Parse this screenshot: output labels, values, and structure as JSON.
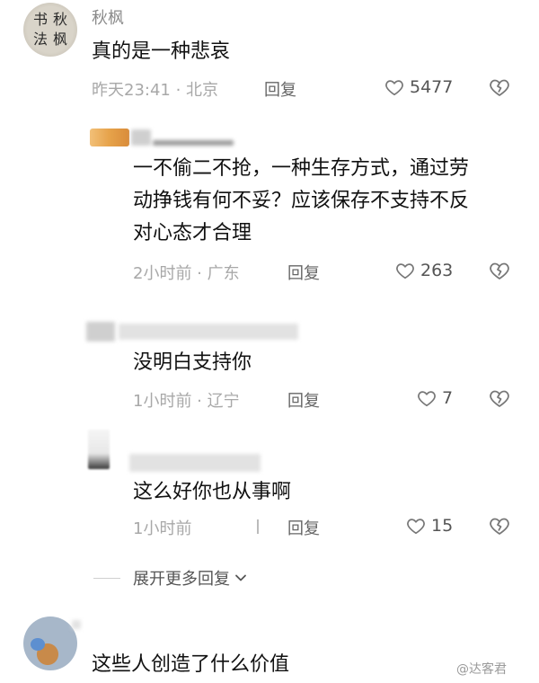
{
  "comments": [
    {
      "username": "秋枫",
      "avatar_text": [
        "书",
        "秋",
        "法",
        "枫"
      ],
      "text": "真的是一种悲哀",
      "meta": "昨天23:41 · 北京",
      "reply_label": "回复",
      "likes": "5477"
    },
    {
      "text_lines": [
        "一不偷二不抢，一种生存方式，通过劳",
        "动挣钱有何不妥？应该保存不支持不反",
        "对心态才合理"
      ],
      "meta": "2小时前 · 广东",
      "reply_label": "回复",
      "likes": "263"
    },
    {
      "text": "没明白支持你",
      "meta": "1小时前 · 辽宁",
      "reply_label": "回复",
      "likes": "7"
    },
    {
      "text": "这么好你也从事啊",
      "meta": "1小时前",
      "reply_label": "回复",
      "likes": "15"
    }
  ],
  "expand_more": "展开更多回复",
  "last_comment": {
    "text": "这些人创造了什么价值"
  },
  "watermark": "@达客君",
  "icons": {
    "like": "heart-outline-icon",
    "dislike": "broken-heart-icon",
    "expand": "chevron-down-icon"
  }
}
